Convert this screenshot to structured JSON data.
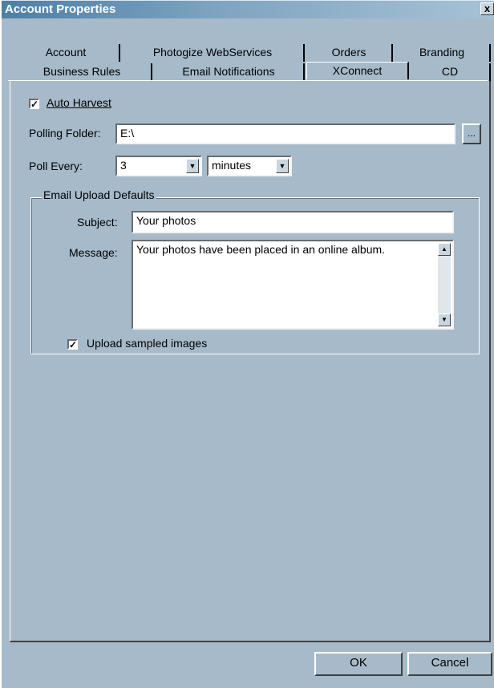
{
  "window": {
    "title": "Account Properties",
    "close_glyph": "x"
  },
  "tabs": {
    "row1": [
      "Account",
      "Photogize WebServices",
      "Orders",
      "Branding"
    ],
    "row2": [
      "Business Rules",
      "Email Notifications",
      "XConnect",
      "CD"
    ],
    "active": "XConnect"
  },
  "xconnect": {
    "auto_harvest": {
      "label": "Auto Harvest",
      "checked": true
    },
    "polling_folder": {
      "label": "Polling Folder:",
      "value": "E:\\",
      "browse_label": "..."
    },
    "poll_every": {
      "label": "Poll Every:",
      "value": "3",
      "unit": "minutes"
    }
  },
  "email_defaults": {
    "group_title": "Email Upload Defaults",
    "subject_label": "Subject:",
    "subject_value": "Your photos",
    "message_label": "Message:",
    "message_value": "Your photos have been placed in an online album.",
    "upload_sampled": {
      "label": "Upload sampled images",
      "checked": true
    }
  },
  "buttons": {
    "ok": "OK",
    "cancel": "Cancel"
  },
  "colors": {
    "dialog_bg": "#a6bac9",
    "title_start": "#4d7fa5",
    "title_end": "#a6c2d6"
  }
}
